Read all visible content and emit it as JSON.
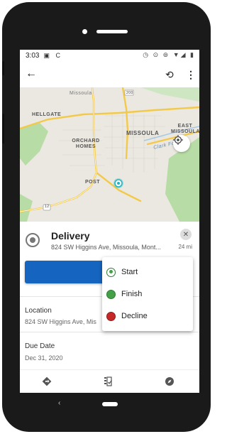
{
  "status_bar": {
    "time": "3:03",
    "left_icons": "▣ C",
    "right_icons": "◷ ⊙ ⊚ ▼◢ ▮"
  },
  "app_bar": {
    "back_icon": "arrow-back-icon",
    "sync_icon": "sync-icon",
    "more_icon": "more-vert-icon"
  },
  "map": {
    "labels": [
      "Missoula",
      "HELLGATE",
      "MISSOULA",
      "EAST MISSOULA",
      "ORCHARD HOMES",
      "Clark Fork",
      "POST",
      "200",
      "12"
    ],
    "colors": {
      "land": "#ebe8e2",
      "park": "#b7dca5",
      "road": "#f3c94a",
      "marker": "#1fb6c4"
    }
  },
  "task": {
    "title": "Delivery",
    "address": "824 SW Higgins Ave, Missoula, Mont...",
    "distance": "24 mi"
  },
  "action_menu": {
    "items": [
      {
        "label": "Start",
        "color": "#43a047",
        "selected": true
      },
      {
        "label": "Finish",
        "color": "#43a047",
        "selected": false
      },
      {
        "label": "Decline",
        "color": "#c62828",
        "selected": false
      }
    ]
  },
  "fields": {
    "location_label": "Location",
    "location_value": "824 SW Higgins Ave, Mis",
    "due_label": "Due Date",
    "due_value": "Dec 31, 2020"
  },
  "bottom_nav": {
    "items": [
      "directions-icon",
      "checklist-icon",
      "compass-icon"
    ]
  },
  "colors": {
    "accent": "#1565c0"
  }
}
